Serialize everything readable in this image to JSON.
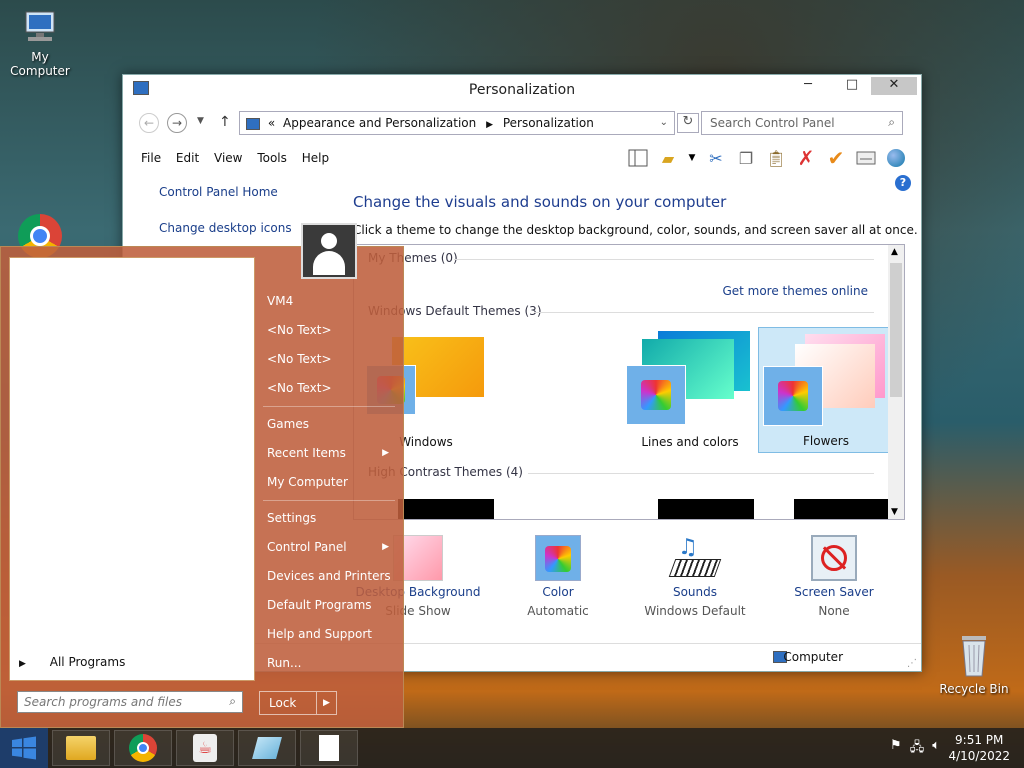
{
  "desktop": {
    "icons": [
      {
        "label": "My Computer",
        "icon": "computer-icon"
      },
      {
        "label": "Recycle Bin",
        "icon": "recycle-bin-icon"
      }
    ]
  },
  "window": {
    "title": "Personalization",
    "address": {
      "prefix": "«",
      "crumb1": "Appearance and Personalization",
      "crumb2": "Personalization"
    },
    "search_placeholder": "Search Control Panel",
    "menu": [
      "File",
      "Edit",
      "View",
      "Tools",
      "Help"
    ],
    "side_links": [
      "Control Panel Home",
      "Change desktop icons"
    ],
    "heading": "Change the visuals and sounds on your computer",
    "subheading": "Click a theme to change the desktop background, color, sounds, and screen saver all at once.",
    "sections": {
      "my_themes": "My Themes (0)",
      "get_more": "Get more themes online",
      "default_themes": "Windows Default Themes (3)",
      "high_contrast": "High Contrast Themes (4)"
    },
    "themes": [
      {
        "label": "Windows",
        "selected": false
      },
      {
        "label": "Lines and colors",
        "selected": false
      },
      {
        "label": "Flowers",
        "selected": true
      }
    ],
    "bottom_items": [
      {
        "title": "Desktop Background",
        "sub": "Slide Show"
      },
      {
        "title": "Color",
        "sub": "Automatic"
      },
      {
        "title": "Sounds",
        "sub": "Windows Default"
      },
      {
        "title": "Screen Saver",
        "sub": "None"
      }
    ],
    "status": "Computer"
  },
  "start_menu": {
    "all_programs": "All Programs",
    "search_placeholder": "Search programs and files",
    "items_group1": [
      "VM4",
      "<No Text>",
      "<No Text>",
      "<No Text>"
    ],
    "items_group2": [
      {
        "label": "Games",
        "arrow": false
      },
      {
        "label": "Recent Items",
        "arrow": true
      },
      {
        "label": "My Computer",
        "arrow": false
      }
    ],
    "items_group3": [
      {
        "label": "Settings",
        "arrow": false
      },
      {
        "label": "Control Panel",
        "arrow": true
      },
      {
        "label": "Devices and Printers",
        "arrow": false
      },
      {
        "label": "Default Programs",
        "arrow": false
      },
      {
        "label": "Help and Support",
        "arrow": false
      },
      {
        "label": "Run...",
        "arrow": false
      }
    ],
    "lock": "Lock"
  },
  "taskbar": {
    "time": "9:51 PM",
    "date": "4/10/2022"
  }
}
